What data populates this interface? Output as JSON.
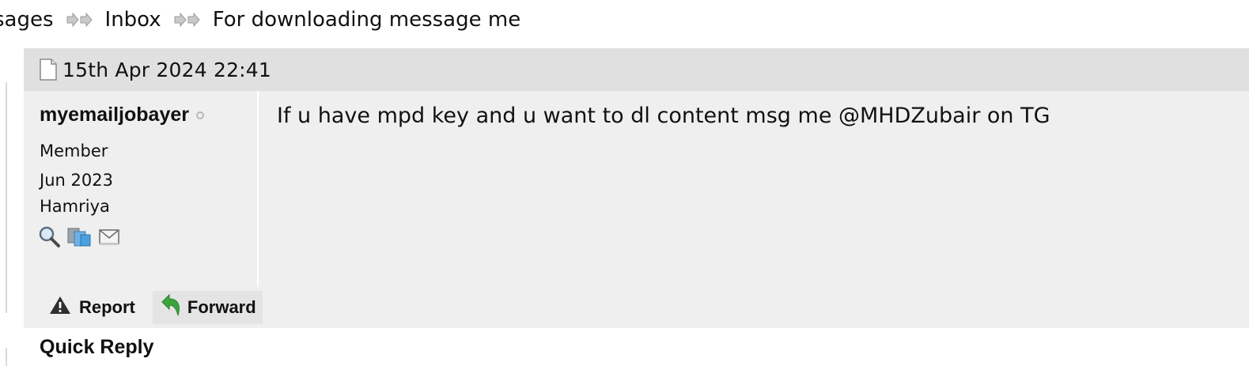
{
  "breadcrumb": {
    "items": [
      "sages",
      "Inbox",
      "For downloading message me"
    ]
  },
  "message": {
    "date": "15th Apr 2024 22:41",
    "user": {
      "username": "myemailjobayer",
      "title": "Member",
      "joined": "Jun 2023",
      "location": "Hamriya",
      "icons": [
        "search-icon",
        "users-icon",
        "envelope-icon"
      ]
    },
    "body": "If u have mpd key and u want to dl content msg me @MHDZubair on TG",
    "actions": {
      "report_label": "Report",
      "forward_label": "Forward"
    }
  },
  "quick_reply": {
    "heading": "Quick Reply"
  },
  "colors": {
    "panel": "#eeefee",
    "header": "#dfe0df",
    "forward_arrow": "#3aa63a"
  }
}
